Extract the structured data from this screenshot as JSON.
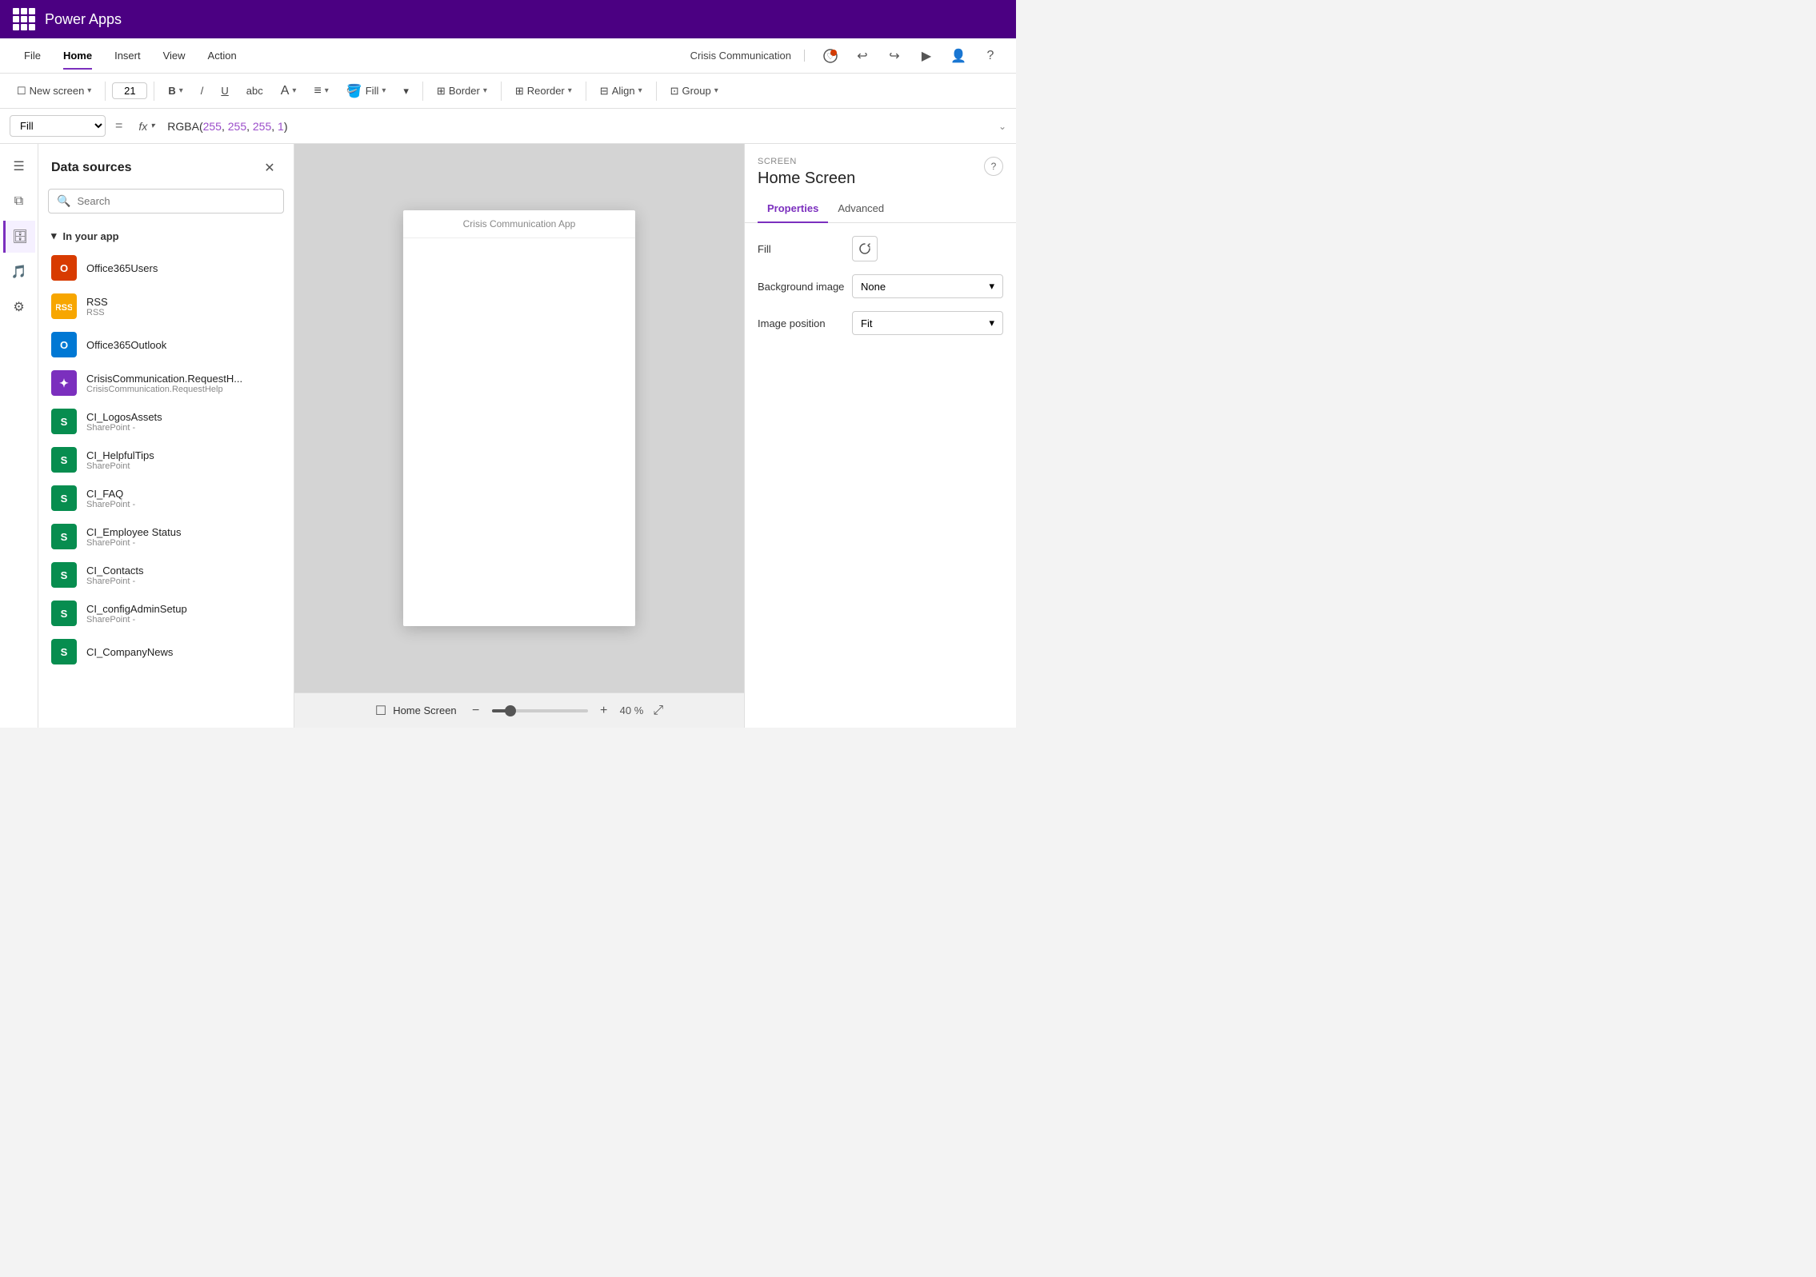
{
  "titlebar": {
    "app_name": "Power Apps"
  },
  "menubar": {
    "items": [
      {
        "label": "File",
        "active": false
      },
      {
        "label": "Home",
        "active": true
      },
      {
        "label": "Insert",
        "active": false
      },
      {
        "label": "View",
        "active": false
      },
      {
        "label": "Action",
        "active": false
      }
    ],
    "app_name": "Crisis Communication",
    "icons": [
      "notifications",
      "undo",
      "redo",
      "play",
      "person",
      "help"
    ]
  },
  "toolbar": {
    "new_screen_label": "New screen",
    "font_size": "21",
    "bold_label": "B",
    "strikethrough_label": "abc",
    "fill_label": "Fill",
    "border_label": "Border",
    "reorder_label": "Reorder",
    "align_label": "Align",
    "group_label": "Group"
  },
  "formula_bar": {
    "property": "Fill",
    "fx_label": "fx",
    "formula": "RGBA(255, 255, 255, 1)",
    "rgba_label": "RGBA(",
    "values": [
      "255",
      "255",
      "255",
      "1"
    ],
    "closing": ")"
  },
  "data_panel": {
    "title": "Data sources",
    "search_placeholder": "Search",
    "section_label": "In your app",
    "items": [
      {
        "name": "Office365Users",
        "subtitle": "",
        "icon_type": "office365",
        "icon_text": "O"
      },
      {
        "name": "RSS",
        "subtitle": "RSS",
        "icon_type": "rss",
        "icon_text": "R"
      },
      {
        "name": "Office365Outlook",
        "subtitle": "",
        "icon_type": "outlook",
        "icon_text": "O"
      },
      {
        "name": "CrisisCommunication.RequestH...",
        "subtitle": "CrisisCommunication.RequestHelp",
        "icon_type": "crisis",
        "icon_text": "✦"
      },
      {
        "name": "CI_LogosAssets",
        "subtitle": "SharePoint -",
        "icon_type": "sharepoint",
        "icon_text": "S"
      },
      {
        "name": "CI_HelpfulTips",
        "subtitle": "SharePoint",
        "icon_type": "sharepoint",
        "icon_text": "S"
      },
      {
        "name": "CI_FAQ",
        "subtitle": "SharePoint -",
        "icon_type": "sharepoint",
        "icon_text": "S"
      },
      {
        "name": "CI_Employee Status",
        "subtitle": "SharePoint -",
        "icon_type": "sharepoint",
        "icon_text": "S"
      },
      {
        "name": "CI_Contacts",
        "subtitle": "SharePoint -",
        "icon_type": "sharepoint",
        "icon_text": "S"
      },
      {
        "name": "CI_configAdminSetup",
        "subtitle": "SharePoint -",
        "icon_type": "sharepoint",
        "icon_text": "S"
      },
      {
        "name": "CI_CompanyNews",
        "subtitle": "",
        "icon_type": "sharepoint",
        "icon_text": "S"
      }
    ]
  },
  "canvas": {
    "app_title": "Crisis Communication App",
    "screen_name": "Home Screen",
    "zoom_label": "40",
    "zoom_unit": "%"
  },
  "properties_panel": {
    "screen_label": "SCREEN",
    "screen_name": "Home Screen",
    "tabs": [
      {
        "label": "Properties",
        "active": true
      },
      {
        "label": "Advanced",
        "active": false
      }
    ],
    "fill_label": "Fill",
    "background_image_label": "Background image",
    "background_image_value": "None",
    "image_position_label": "Image position",
    "image_position_value": "Fit"
  }
}
